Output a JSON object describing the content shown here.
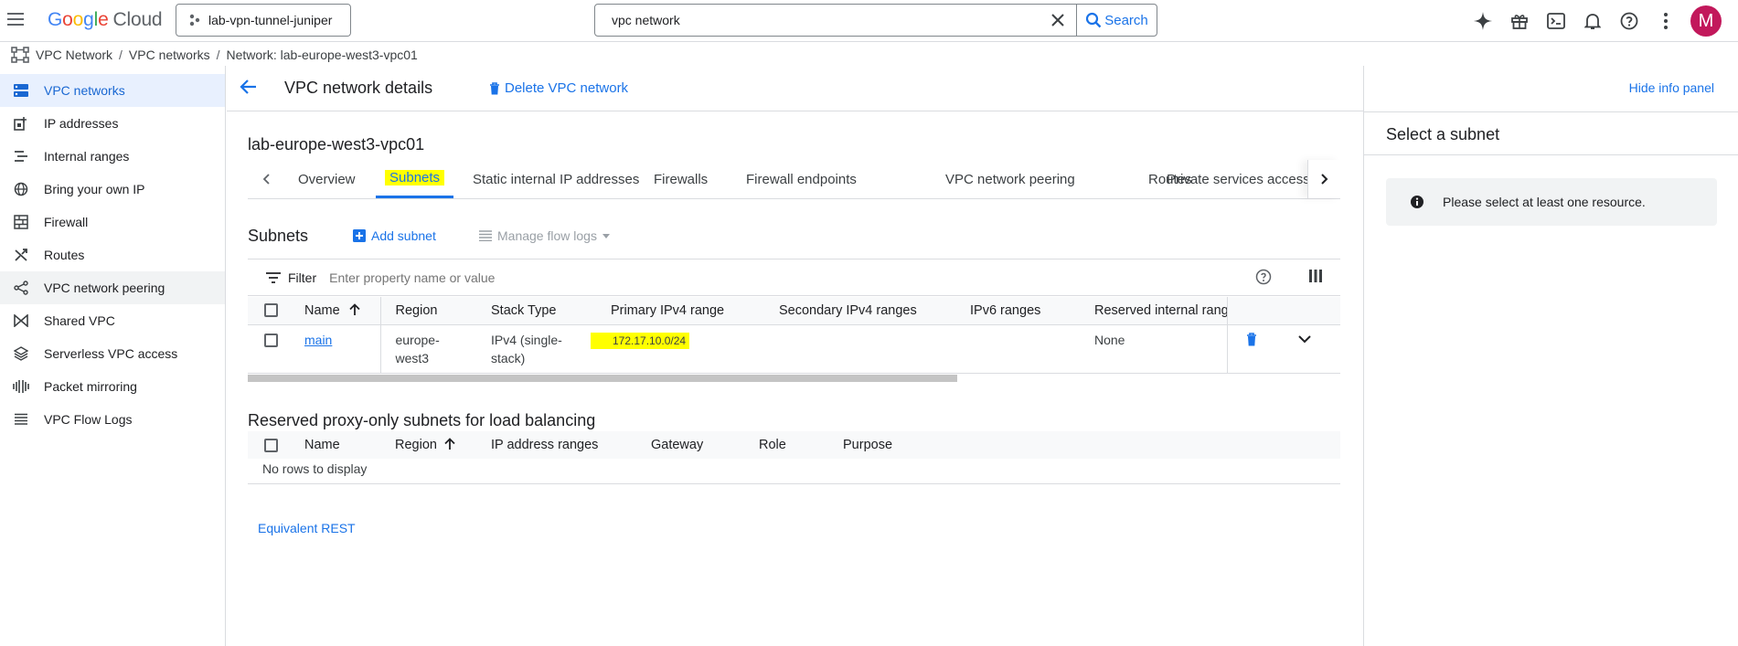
{
  "topbar": {
    "logo": {
      "g1": "G",
      "g2": "o",
      "g3": "o",
      "g4": "g",
      "g5": "l",
      "g6": "e",
      "cloud": "Cloud"
    },
    "project": "lab-vpn-tunnel-juniper",
    "search_value": "vpc network",
    "search_button": "Search",
    "avatar_letter": "M"
  },
  "breadcrumb": {
    "items": [
      "VPC Network",
      "VPC networks",
      "Network: lab-europe-west3-vpc01"
    ],
    "separator": "/"
  },
  "sidebar": {
    "items": [
      {
        "label": "VPC networks",
        "icon": "vpc-networks-icon"
      },
      {
        "label": "IP addresses",
        "icon": "ip-addresses-icon"
      },
      {
        "label": "Internal ranges",
        "icon": "internal-ranges-icon"
      },
      {
        "label": "Bring your own IP",
        "icon": "globe-icon"
      },
      {
        "label": "Firewall",
        "icon": "firewall-icon"
      },
      {
        "label": "Routes",
        "icon": "routes-icon"
      },
      {
        "label": "VPC network peering",
        "icon": "peering-icon"
      },
      {
        "label": "Shared VPC",
        "icon": "shared-vpc-icon"
      },
      {
        "label": "Serverless VPC access",
        "icon": "serverless-icon"
      },
      {
        "label": "Packet mirroring",
        "icon": "packet-mirroring-icon"
      },
      {
        "label": "VPC Flow Logs",
        "icon": "flow-logs-icon"
      }
    ]
  },
  "page": {
    "title": "VPC network details",
    "delete_label": "Delete VPC network",
    "network_name": "lab-europe-west3-vpc01",
    "tabs": [
      "Overview",
      "Subnets",
      "Static internal IP addresses",
      "Firewalls",
      "Firewall endpoints",
      "Routes",
      "VPC network peering",
      "Private services access"
    ],
    "active_tab": "Subnets"
  },
  "subnets": {
    "heading": "Subnets",
    "add_label": "Add subnet",
    "flow_logs_label": "Manage flow logs",
    "filter_label": "Filter",
    "filter_placeholder": "Enter property name or value",
    "columns": [
      "Name",
      "Region",
      "Stack Type",
      "Primary IPv4 range",
      "Secondary IPv4 ranges",
      "IPv6 ranges",
      "Reserved internal ranges"
    ],
    "rows": [
      {
        "name": "main",
        "region_1": "europe-",
        "region_2": "west3",
        "stack_1": "IPv4 (single-",
        "stack_2": "stack)",
        "primary": "172.17.10.0/24",
        "secondary": "",
        "ipv6": "",
        "reserved": "None"
      }
    ]
  },
  "proxy": {
    "heading": "Reserved proxy-only subnets for load balancing",
    "columns": [
      "Name",
      "Region",
      "IP address ranges",
      "Gateway",
      "Role",
      "Purpose"
    ],
    "empty": "No rows to display"
  },
  "equivalent_rest": "Equivalent REST",
  "info_panel": {
    "hide_label": "Hide info panel",
    "title": "Select a subnet",
    "message": "Please select at least one resource."
  },
  "colors": {
    "accent": "#1a73e8",
    "highlight": "#ffff00",
    "active_nav_bg": "#e8f0fe",
    "avatar": "#c2185b"
  }
}
